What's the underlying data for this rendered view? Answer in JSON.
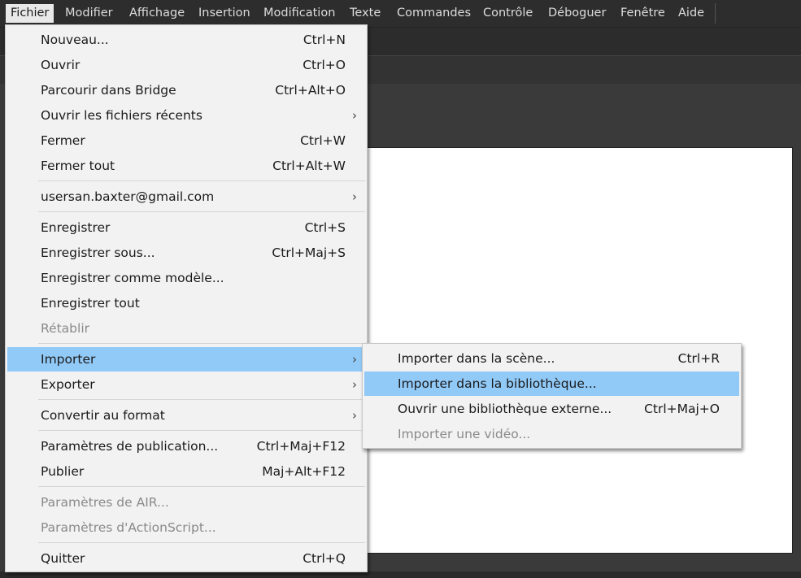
{
  "menubar": {
    "items": [
      "Fichier",
      "Modifier",
      "Affichage",
      "Insertion",
      "Modification",
      "Texte",
      "Commandes",
      "Contrôle",
      "Déboguer",
      "Fenêtre",
      "Aide"
    ]
  },
  "file_menu": {
    "nouveau": {
      "label": "Nouveau...",
      "shortcut": "Ctrl+N"
    },
    "ouvrir": {
      "label": "Ouvrir",
      "shortcut": "Ctrl+O"
    },
    "bridge": {
      "label": "Parcourir dans Bridge",
      "shortcut": "Ctrl+Alt+O"
    },
    "recents": {
      "label": "Ouvrir les fichiers récents"
    },
    "fermer": {
      "label": "Fermer",
      "shortcut": "Ctrl+W"
    },
    "fermer_tout": {
      "label": "Fermer tout",
      "shortcut": "Ctrl+Alt+W"
    },
    "account": {
      "label": "usersan.baxter@gmail.com"
    },
    "enregistrer": {
      "label": "Enregistrer",
      "shortcut": "Ctrl+S"
    },
    "enregistrer_sous": {
      "label": "Enregistrer sous...",
      "shortcut": "Ctrl+Maj+S"
    },
    "modele": {
      "label": "Enregistrer comme modèle..."
    },
    "enregistrer_tout": {
      "label": "Enregistrer tout"
    },
    "retablir": {
      "label": "Rétablir"
    },
    "importer": {
      "label": "Importer"
    },
    "exporter": {
      "label": "Exporter"
    },
    "convertir": {
      "label": "Convertir au format"
    },
    "param_pub": {
      "label": "Paramètres de publication...",
      "shortcut": "Ctrl+Maj+F12"
    },
    "publier": {
      "label": "Publier",
      "shortcut": "Maj+Alt+F12"
    },
    "param_air": {
      "label": "Paramètres de AIR..."
    },
    "param_as": {
      "label": "Paramètres d'ActionScript..."
    },
    "quitter": {
      "label": "Quitter",
      "shortcut": "Ctrl+Q"
    }
  },
  "import_submenu": {
    "scene": {
      "label": "Importer dans la scène...",
      "shortcut": "Ctrl+R"
    },
    "bibliotheque": {
      "label": "Importer dans la bibliothèque..."
    },
    "externe": {
      "label": "Ouvrir une bibliothèque externe...",
      "shortcut": "Ctrl+Maj+O"
    },
    "video": {
      "label": "Importer une vidéo..."
    }
  },
  "icons": {
    "submenu_arrow": "›"
  },
  "colors": {
    "highlight": "#91c9f7",
    "menu_bg": "#f2f2f2",
    "menubar_bg": "#2d2d2d"
  }
}
